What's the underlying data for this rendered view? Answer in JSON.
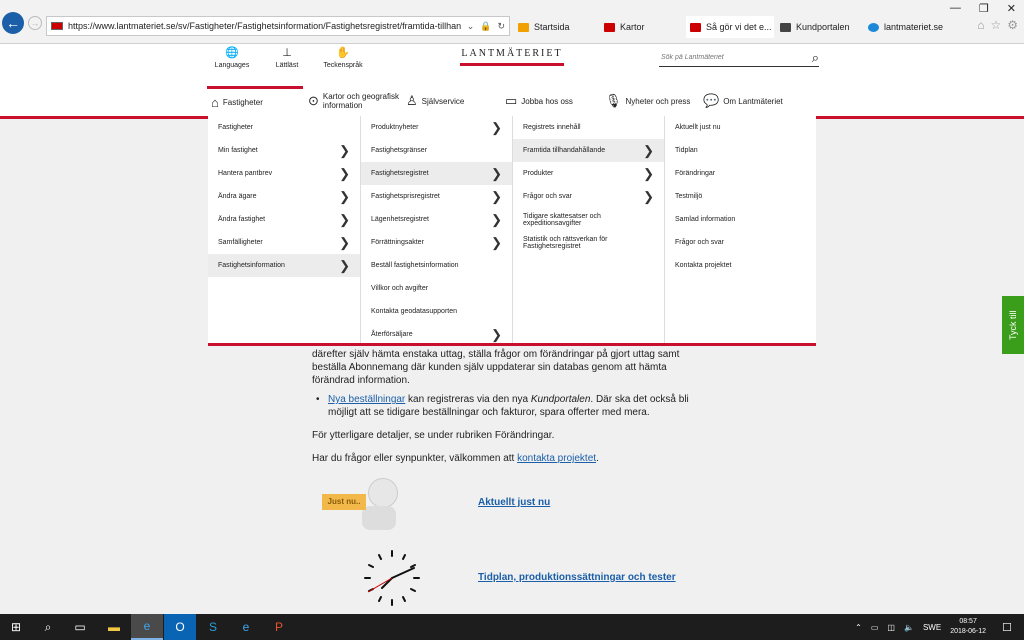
{
  "browser": {
    "url": "https://www.lantmateriet.se/sv/Fastigheter/Fastighetsinformation/Fastighetsregistret/framtida-tillhandahalland",
    "tabs": [
      {
        "label": "Startsida",
        "active": false
      },
      {
        "label": "Kartor",
        "active": false
      },
      {
        "label": "Så gör vi det e...",
        "active": true
      },
      {
        "label": "Kundportalen",
        "active": false
      },
      {
        "label": "lantmateriet.se",
        "active": false
      }
    ],
    "window_controls": [
      "—",
      "❐",
      "✕"
    ]
  },
  "header": {
    "utilities": [
      {
        "label": "Languages",
        "icon": "globe-icon"
      },
      {
        "label": "Lättläst",
        "icon": "easy-read-icon"
      },
      {
        "label": "Teckenspråk",
        "icon": "sign-language-icon"
      }
    ],
    "logo_text": "LANTMÄTERIET",
    "search_placeholder": "Sök på Lantmäteriet"
  },
  "nav": {
    "items": [
      {
        "label": "Fastigheter",
        "icon": "home-icon",
        "active": true
      },
      {
        "label": "Kartor och geografisk information",
        "icon": "location-pin-icon",
        "active": false
      },
      {
        "label": "Självservice",
        "icon": "person-icon",
        "active": false
      },
      {
        "label": "Jobba hos oss",
        "icon": "briefcase-icon",
        "active": false
      },
      {
        "label": "Nyheter och press",
        "icon": "microphone-icon",
        "active": false
      },
      {
        "label": "Om Lantmäteriet",
        "icon": "speech-bubble-icon",
        "active": false
      }
    ]
  },
  "mega_menu": {
    "columns": [
      [
        {
          "label": "Fastigheter",
          "arrow": false,
          "highlighted": false
        },
        {
          "label": "Min fastighet",
          "arrow": true,
          "highlighted": false
        },
        {
          "label": "Hantera pantbrev",
          "arrow": true,
          "highlighted": false
        },
        {
          "label": "Ändra ägare",
          "arrow": true,
          "highlighted": false
        },
        {
          "label": "Ändra fastighet",
          "arrow": true,
          "highlighted": false
        },
        {
          "label": "Samfälligheter",
          "arrow": true,
          "highlighted": false
        },
        {
          "label": "Fastighetsinformation",
          "arrow": true,
          "highlighted": true
        }
      ],
      [
        {
          "label": "Produktnyheter",
          "arrow": true,
          "highlighted": false
        },
        {
          "label": "Fastighetsgränser",
          "arrow": false,
          "highlighted": false
        },
        {
          "label": "Fastighetsregistret",
          "arrow": true,
          "highlighted": true
        },
        {
          "label": "Fastighetsprisregistret",
          "arrow": true,
          "highlighted": false
        },
        {
          "label": "Lägenhetsregistret",
          "arrow": true,
          "highlighted": false
        },
        {
          "label": "Förrättningsakter",
          "arrow": true,
          "highlighted": false
        },
        {
          "label": "Beställ fastighetsinformation",
          "arrow": false,
          "highlighted": false
        },
        {
          "label": "Villkor och avgifter",
          "arrow": false,
          "highlighted": false
        },
        {
          "label": "Kontakta geodatasupporten",
          "arrow": false,
          "highlighted": false
        },
        {
          "label": "Återförsäljare",
          "arrow": true,
          "highlighted": false
        }
      ],
      [
        {
          "label": "Registrets innehåll",
          "arrow": false,
          "highlighted": false
        },
        {
          "label": "Framtida tillhandahållande",
          "arrow": true,
          "highlighted": true
        },
        {
          "label": "Produkter",
          "arrow": true,
          "highlighted": false
        },
        {
          "label": "Frågor och svar",
          "arrow": true,
          "highlighted": false
        },
        {
          "label": "Tidigare skattesatser och expeditionsavgifter",
          "arrow": false,
          "highlighted": false
        },
        {
          "label": "Statistik och rättsverkan för Fastighetsregistret",
          "arrow": false,
          "highlighted": false
        }
      ],
      [
        {
          "label": "Aktuellt just nu",
          "arrow": false,
          "highlighted": false
        },
        {
          "label": "Tidplan",
          "arrow": false,
          "highlighted": false
        },
        {
          "label": "Förändringar",
          "arrow": false,
          "highlighted": false
        },
        {
          "label": "Testmiljö",
          "arrow": false,
          "highlighted": false
        },
        {
          "label": "Samlad information",
          "arrow": false,
          "highlighted": false
        },
        {
          "label": "Frågor och svar",
          "arrow": false,
          "highlighted": false
        },
        {
          "label": "Kontakta projektet",
          "arrow": false,
          "highlighted": false
        }
      ]
    ]
  },
  "content": {
    "para_top": "därefter själv hämta enstaka uttag, ställa frågor om förändringar på gjort uttag samt beställa Abonnemang där kunden själv uppdaterar sin databas genom att hämta förändrad information.",
    "bullet_link": "Nya beställningar",
    "bullet_text_1": " kan registreras via den nya ",
    "bullet_em": "Kundportalen",
    "bullet_text_2": ". Där ska det också bli möjligt att se tidigare beställningar och fakturor, spara offerter med mera.",
    "para_details": "För ytterligare detaljer, se under rubriken Förändringar.",
    "para_contact_pre": "Har du frågor eller synpunkter, välkommen att ",
    "para_contact_link": "kontakta projektet",
    "para_contact_post": ".",
    "justnu_sign": "Just nu..",
    "link_aktuellt": "Aktuellt just nu",
    "link_tidplan": "Tidplan, produktionssättningar och tester",
    "feedback_tab": "Tyck till"
  },
  "taskbar": {
    "language": "SWE",
    "time": "08:57",
    "date": "2018-06-12"
  }
}
